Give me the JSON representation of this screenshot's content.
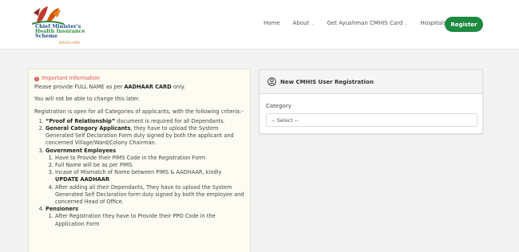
{
  "header": {
    "logo": {
      "line1": "Chief Minister's",
      "line2": "Health Insurance",
      "line3": "Scheme",
      "sub": "NAGALAND"
    },
    "nav": [
      {
        "label": "Home",
        "has_dropdown": false
      },
      {
        "label": "About",
        "has_dropdown": true
      },
      {
        "label": "Get Ayushman CMHIS Card",
        "has_dropdown": true
      },
      {
        "label": "Hospitals",
        "has_dropdown": true
      }
    ],
    "register_label": "Register",
    "colors": {
      "register_bg": "#1c8a3f",
      "info_title": "#d9534f"
    }
  },
  "info": {
    "title": "Important Information",
    "p1_prefix": "Please provide FULL NAME as per ",
    "p1_bold": "AADHAAR CARD",
    "p1_suffix": " only.",
    "p2": "You will not be able to change this later.",
    "p3": "Registration is open for all Categories of applicants, with the following criteria:-",
    "item1_bold": "“Proof of Relationship”",
    "item1_rest": " document is required for all Dependants.",
    "item2_bold": "General Category Applicants",
    "item2_rest": ", they have to upload the System Generated Self Declaration Form duly signed by both the applicant and concerned Village/Ward/Colony Chairman.",
    "item3_bold": "Government Employees",
    "item3_sub": [
      "Have to Provide their PIMS Code in the Registration Form",
      "Full Name will be as per PIMS"
    ],
    "item3_sub3_prefix": "Incase of Mismatch of Name between PIMS & AADHAAR, kindly ",
    "item3_sub3_bold": "UPDATE AADHAAR",
    "item3_sub4": "After adding all their Dependants, They have to upload the System Generated Self Declaration form duly signed by both the employee and concerned Head of Office.",
    "item4_bold": "Pensioners",
    "item4_sub1": "After Registration they have to Provide their PPO Code in the Application Form"
  },
  "registration": {
    "title": "New CMHIS User Registration",
    "category_label": "Category",
    "select_value": "-- Select --"
  },
  "icons": {
    "info": "info-circle-icon",
    "user": "user-circle-icon",
    "dropdown": "chevron-down-icon"
  }
}
